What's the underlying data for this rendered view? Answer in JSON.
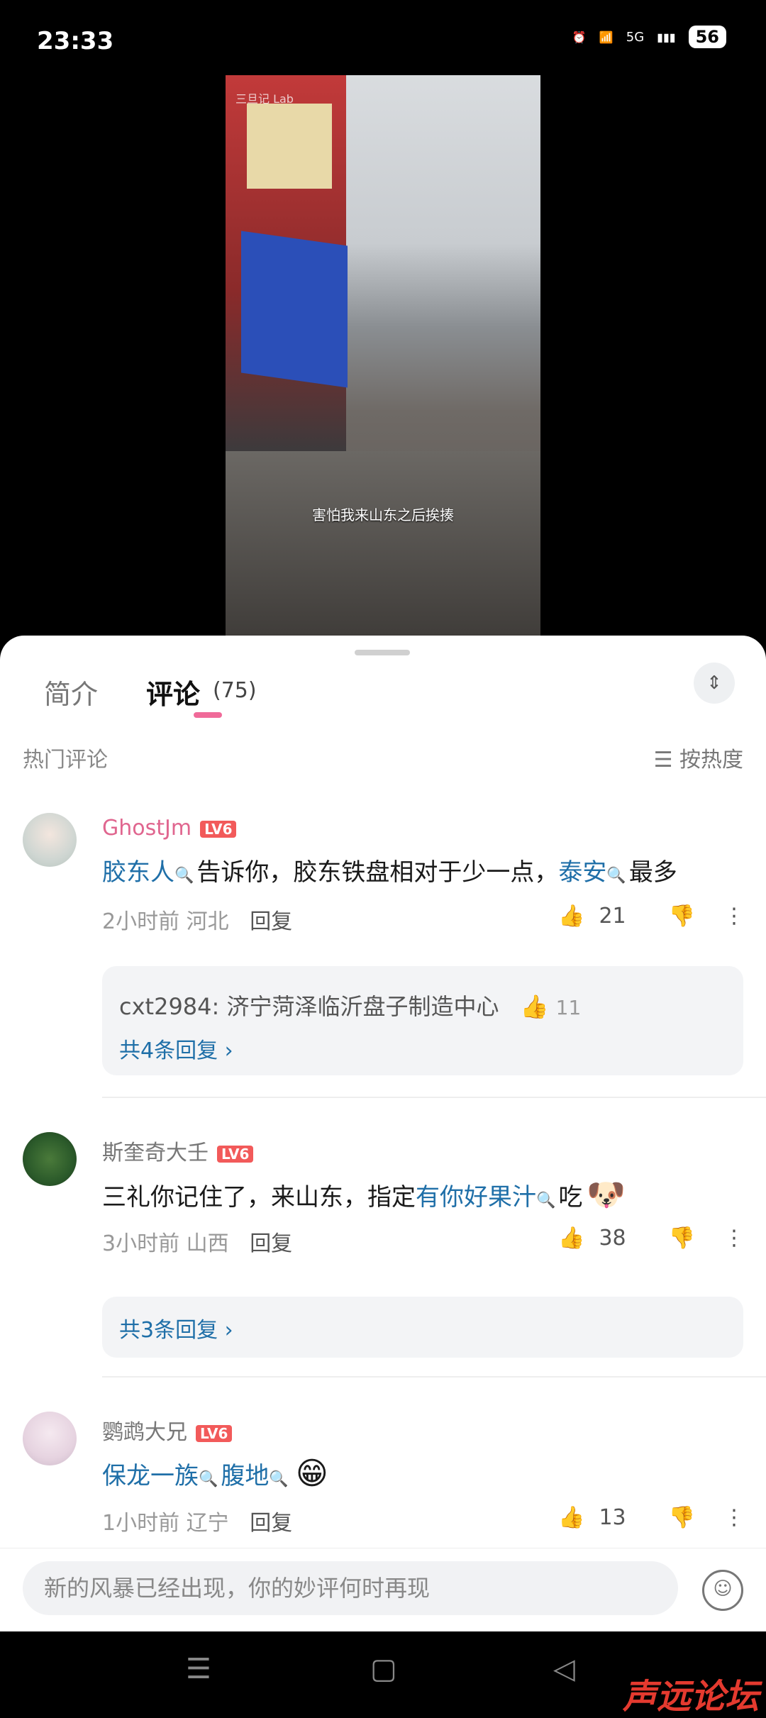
{
  "status": {
    "time": "23:33",
    "network": "5G",
    "battery": "56"
  },
  "video": {
    "watermark": "三旦记 Lab",
    "subtitle": "害怕我来山东之后挨揍"
  },
  "tabs": {
    "intro": "简介",
    "comments": "评论",
    "count": "(75)"
  },
  "section": {
    "hot_label": "热门评论",
    "sort_label": "按热度"
  },
  "comments": [
    {
      "user": "GhostJm",
      "level": "LV6",
      "parts": [
        {
          "t": "胶东人",
          "link": true
        },
        {
          "t": "告诉你，胶东铁盘相对于少一点，",
          "link": false
        },
        {
          "t": "泰安",
          "link": true
        },
        {
          "t": "最多",
          "link": false
        }
      ],
      "time": "2小时前",
      "region": "河北",
      "reply_label": "回复",
      "likes": "21",
      "sub_reply": {
        "user": "cxt2984",
        "text": "济宁菏泽临沂盘子制造中心",
        "likes": "11"
      },
      "more_replies": "共4条回复"
    },
    {
      "user": "斯奎奇大壬",
      "level": "LV6",
      "parts": [
        {
          "t": "三礼你记住了，来山东，指定",
          "link": false
        },
        {
          "t": "有你好果汁",
          "link": true
        },
        {
          "t": "吃",
          "link": false
        }
      ],
      "emoji": "🐶",
      "time": "3小时前",
      "region": "山西",
      "reply_label": "回复",
      "likes": "38",
      "more_replies": "共3条回复"
    },
    {
      "user": "鹦鹉大兄",
      "level": "LV6",
      "parts": [
        {
          "t": "保龙一族",
          "link": true
        },
        {
          "t": "腹地",
          "link": true
        }
      ],
      "emoji": "😁",
      "time": "1小时前",
      "region": "辽宁",
      "reply_label": "回复",
      "likes": "13"
    }
  ],
  "input": {
    "placeholder": "新的风暴已经出现，你的妙评何时再现"
  },
  "brand": "声远论坛",
  "colors": {
    "accent": "#f06a99",
    "link": "#1f6fa8",
    "level_badge": "#f25a5a",
    "username_pink": "#e0668f"
  }
}
